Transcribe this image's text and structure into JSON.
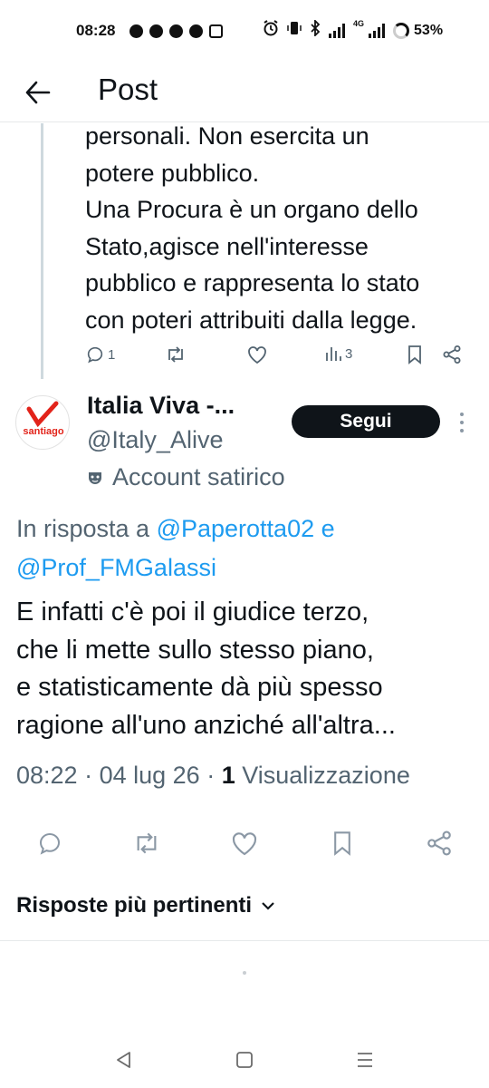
{
  "status_bar": {
    "time": "08:28",
    "network": "4G",
    "battery": "53%"
  },
  "header": {
    "title": "Post"
  },
  "previous_post": {
    "text": "personali. Non esercita un\npotere pubblico.\nUna Procura è un organo dello\nStato,agisce nell'interesse\npubblico e rappresenta lo stato\ncon poteri attribuiti dalla legge.",
    "reply_count": "1",
    "view_count": "3"
  },
  "author": {
    "avatar_text": "santiago",
    "name": "Italia Viva -...",
    "handle": "@Italy_Alive",
    "follow_label": "Segui",
    "label": "Account satirico"
  },
  "reply_to": {
    "prefix": "In risposta a ",
    "mention_1": "@Paperotta02",
    "connector": " e",
    "mention_2": "@Prof_FMGalassi"
  },
  "post": {
    "text": "E infatti c'è poi il giudice terzo,\nche li mette sullo stesso piano,\ne statisticamente dà più spesso\nragione all'uno anziché all'altra...",
    "time": "08:22",
    "date": "04 lug 26",
    "views": "1",
    "views_label": "Visualizzazione"
  },
  "sort": {
    "label": "Risposte più pertinenti"
  },
  "colors": {
    "accent": "#1d9bf0",
    "text": "#0f1419",
    "muted": "#536471",
    "follow_bg": "#0f1419",
    "avatar_red": "#e2231a"
  }
}
